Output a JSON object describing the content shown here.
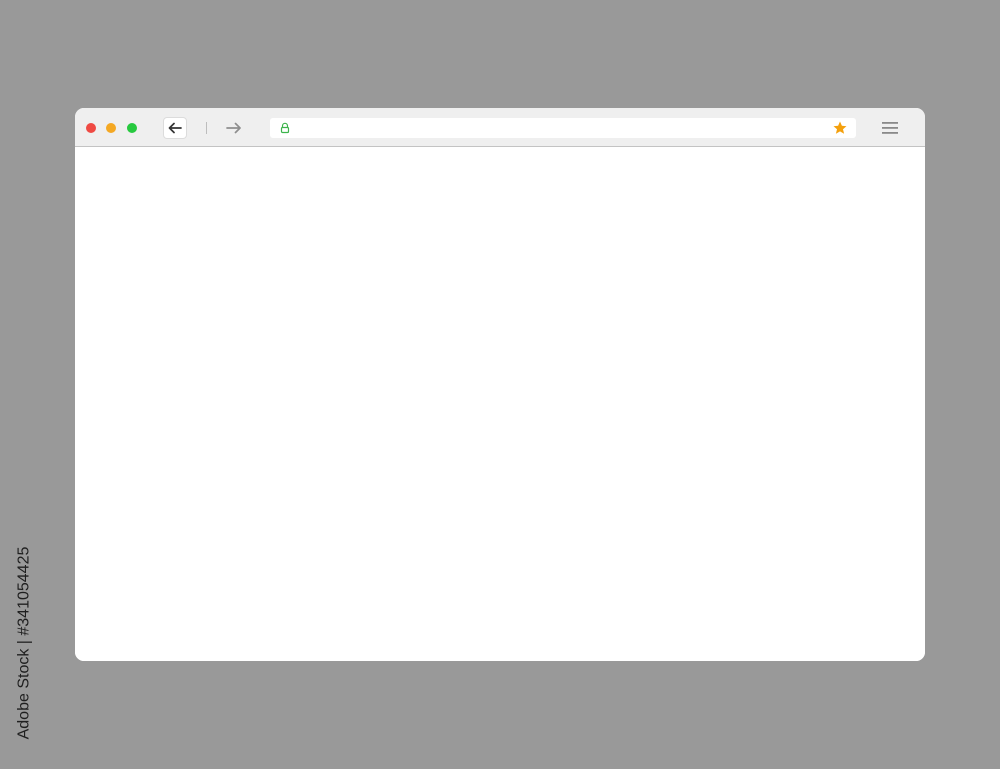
{
  "window": {
    "controls": {
      "close_color": "#ef4a43",
      "minimize_color": "#f4a823",
      "maximize_color": "#27c93f"
    },
    "toolbar": {
      "back_icon": "arrow-left-icon",
      "forward_icon": "arrow-right-icon",
      "menu_icon": "hamburger-menu-icon"
    },
    "address_bar": {
      "url": "",
      "lock_icon": "lock-icon",
      "lock_color": "#3cb44b",
      "bookmark_icon": "star-icon",
      "bookmark_color": "#f4a00d"
    },
    "content": {
      "text": ""
    }
  },
  "watermark": {
    "side_text": "Adobe Stock | #341054425"
  }
}
